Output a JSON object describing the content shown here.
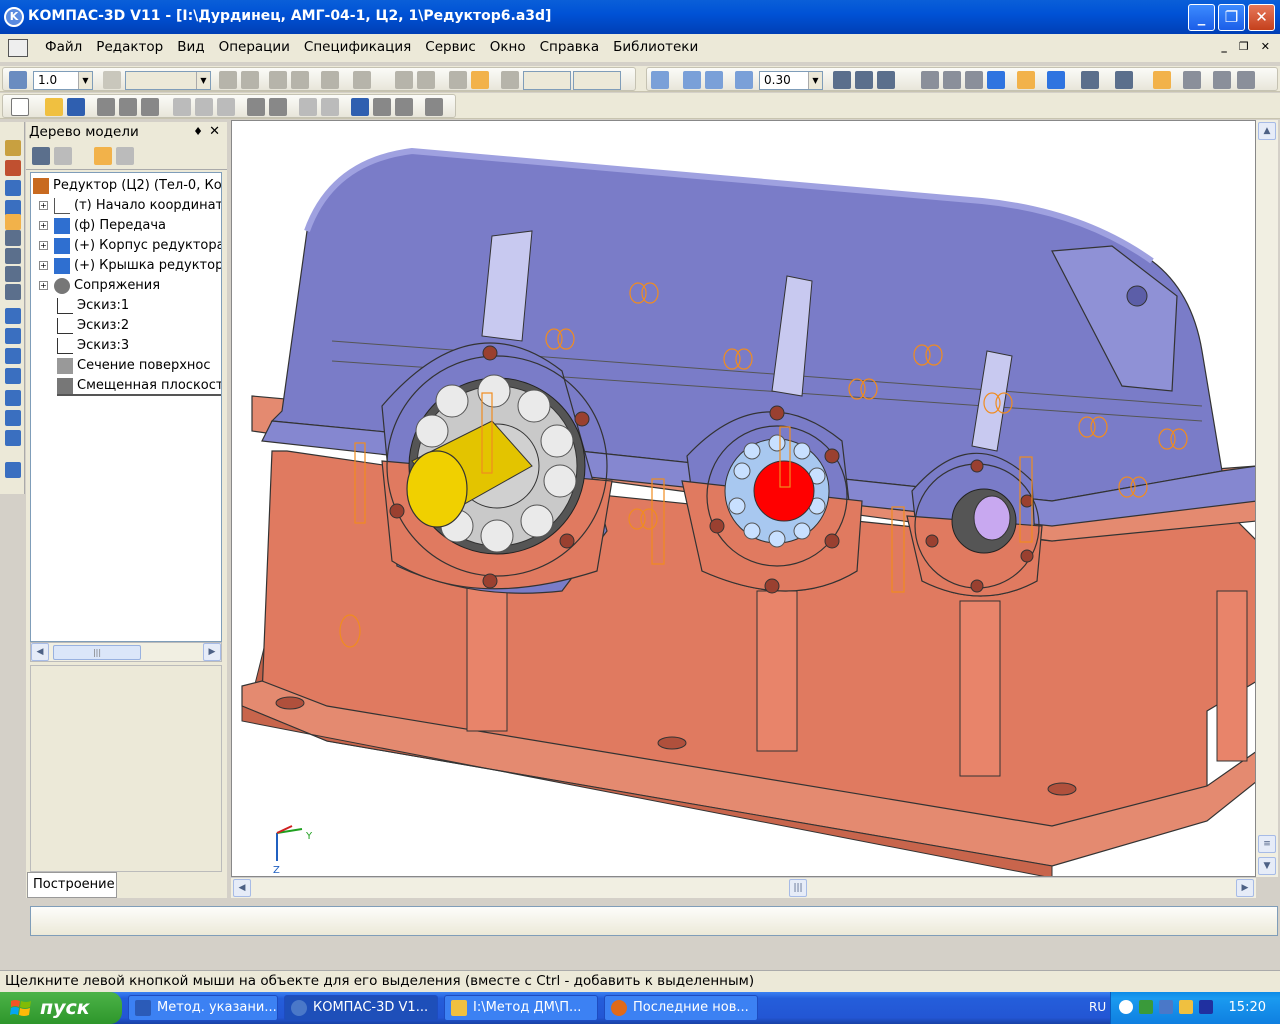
{
  "window": {
    "title": "КОМПАС-3D V11 - [I:\\Дурдинец, АМГ-04-1, Ц2, 1\\Редуктор6.a3d]",
    "minimize": "_",
    "maximize": "❐",
    "close": "✕",
    "app_icon": "K"
  },
  "menu": {
    "items": [
      "Файл",
      "Редактор",
      "Вид",
      "Операции",
      "Спецификация",
      "Сервис",
      "Окно",
      "Справка",
      "Библиотеки"
    ],
    "mdi_minimize": "_",
    "mdi_restore": "❐",
    "mdi_close": "✕"
  },
  "toolbar1": {
    "step_value": "1.0",
    "zoom_value": "0.30"
  },
  "tree_panel": {
    "title": "Дерево модели",
    "pin": "♦",
    "close": "✕",
    "nodes": [
      {
        "label": "Редуктор (Ц2) (Тел-0, Ко",
        "expander": "",
        "icon": "assembly-icon"
      },
      {
        "label": "(т) Начало координат",
        "expander": "+",
        "icon": "origin-icon"
      },
      {
        "label": "(ф) Передача",
        "expander": "+",
        "icon": "part-icon"
      },
      {
        "label": "(+) Корпус редуктора",
        "expander": "+",
        "icon": "part-icon"
      },
      {
        "label": "(+) Крышка редуктора",
        "expander": "+",
        "icon": "part-icon"
      },
      {
        "label": "Сопряжения",
        "expander": "+",
        "icon": "constraint-icon"
      },
      {
        "label": "Эскиз:1",
        "expander": "",
        "icon": "sketch-icon"
      },
      {
        "label": "Эскиз:2",
        "expander": "",
        "icon": "sketch-icon"
      },
      {
        "label": "Эскиз:3",
        "expander": "",
        "icon": "sketch-icon"
      },
      {
        "label": "Сечение поверхнос",
        "expander": "",
        "icon": "section-icon"
      },
      {
        "label": "Смещенная плоскост",
        "expander": "",
        "icon": "plane-icon"
      }
    ],
    "scroll_thumb": "|||",
    "tab_label": "Построение"
  },
  "viewport": {
    "axis_y": "Y",
    "axis_z": "Z"
  },
  "status_text": "Щелкните левой кнопкой мыши на объекте для его выделения (вместе с Ctrl - добавить к выделенным)",
  "taskbar": {
    "start_label": "пуск",
    "tasks": [
      {
        "label": "Метод. указани...",
        "icon": "word-icon",
        "color": "#2b5bb8",
        "active": false
      },
      {
        "label": "КОМПАС-3D V1...",
        "icon": "kompas-icon",
        "color": "#4a78c8",
        "active": true
      },
      {
        "label": "I:\\Метод ДМ\\П...",
        "icon": "folder-icon",
        "color": "#f0c040",
        "active": false
      },
      {
        "label": "Последние нов...",
        "icon": "firefox-icon",
        "color": "#e06a1a",
        "active": false
      }
    ],
    "language": "RU",
    "clock": "15:20"
  },
  "colors": {
    "cover": "#7a7cc8",
    "body": "#e07a60",
    "shaft_yellow": "#f0d000",
    "shaft_red": "#ff0000",
    "shaft_violet": "#c8a8f0"
  }
}
